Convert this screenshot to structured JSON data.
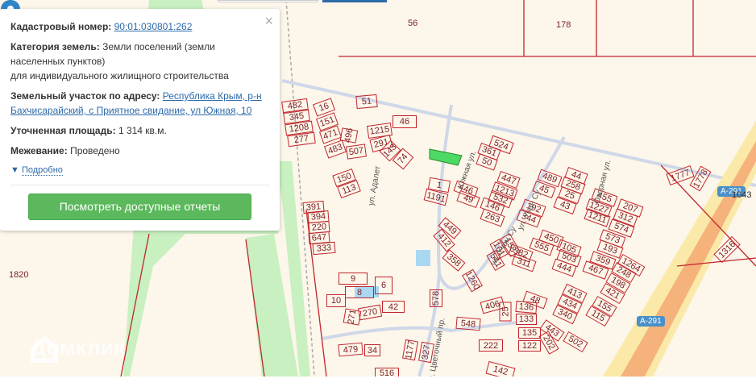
{
  "popup": {
    "cadastral_label": "Кадастровый номер:",
    "cadastral_value": "90:01:030801:262",
    "category_label": "Категория земель:",
    "category_value_1": "Земли поселений (земли",
    "category_value_2": "населенных пунктов)",
    "category_value_3": "для индивидуального жилищного строительства",
    "address_label": "Земельный участок по адресу:",
    "address_value_1": "Республика Крым, р-н",
    "address_value_2": "Бахчисарайский, с Приятное свидание, ул Южная, 10",
    "area_label": "Уточненная площадь:",
    "area_value": "1 314 кв.м.",
    "survey_label": "Межевание:",
    "survey_value": "Проведено",
    "more_label": "Подробно",
    "reports_button": "Посмотреть доступные отчеты",
    "close": "×"
  },
  "map": {
    "big_labels": [
      "56",
      "178",
      "1820"
    ],
    "parcels": [
      "482",
      "345",
      "1208",
      "277",
      "16",
      "151",
      "471",
      "483",
      "496",
      "507",
      "51",
      "46",
      "1215",
      "291",
      "143",
      "74",
      "150",
      "113",
      "391",
      "394",
      "220",
      "647",
      "333",
      "524",
      "361",
      "50",
      "447",
      "446",
      "1213",
      "532",
      "49",
      "146",
      "263",
      "1",
      "1191",
      "192",
      "344",
      "489",
      "45",
      "44",
      "258",
      "25",
      "43",
      "455",
      "1227",
      "1211",
      "207",
      "312",
      "574",
      "573",
      "193",
      "359",
      "467",
      "105",
      "503",
      "444",
      "450",
      "555",
      "382",
      "311",
      "158",
      "541",
      "101",
      "449",
      "412",
      "358",
      "1260",
      "9",
      "6",
      "8",
      "10",
      "42",
      "270",
      "271",
      "578",
      "406",
      "25",
      "548",
      "48",
      "136",
      "133",
      "135",
      "122",
      "413",
      "434",
      "340",
      "443",
      "202",
      "502",
      "421",
      "198",
      "248",
      "1264",
      "155",
      "115",
      "479",
      "34",
      "1177",
      "327",
      "222",
      "142",
      "516",
      "1777",
      "1778",
      "1316"
    ],
    "streets": [
      "ул. Адалет",
      "Южная ул.",
      "ул. Учан Су",
      "Озерная ул.",
      "ул. Учан Су",
      "ул. Цветочный пр."
    ],
    "road_badges": [
      "A-291",
      "A-291"
    ],
    "road_number": "1043",
    "watermark": "Домклик",
    "colors": {
      "parcel": "#c0262d",
      "selected": "#4cd964",
      "green": "#c8f0c0",
      "highway": "#f5b27a"
    }
  }
}
